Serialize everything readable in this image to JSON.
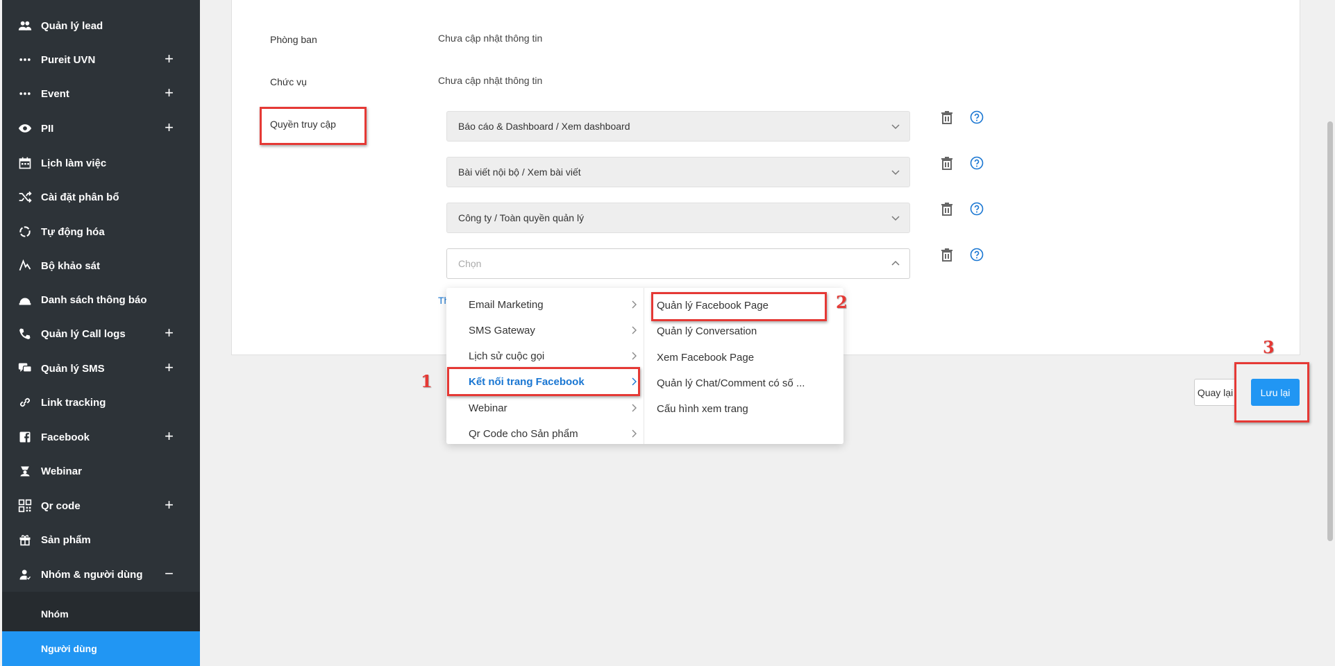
{
  "sidebar": {
    "items": [
      {
        "label": "Quản lý lead",
        "icon": "users-icon",
        "expand": ""
      },
      {
        "label": "Pureit UVN",
        "icon": "dots-icon",
        "expand": "+"
      },
      {
        "label": "Event",
        "icon": "dots-icon",
        "expand": "+"
      },
      {
        "label": "PII",
        "icon": "eye-icon",
        "expand": "+"
      },
      {
        "label": "Lịch làm việc",
        "icon": "calendar-icon",
        "expand": ""
      },
      {
        "label": "Cài đặt phân bổ",
        "icon": "shuffle-icon",
        "expand": ""
      },
      {
        "label": "Tự động hóa",
        "icon": "automation-icon",
        "expand": ""
      },
      {
        "label": "Bộ khảo sát",
        "icon": "survey-icon",
        "expand": ""
      },
      {
        "label": "Danh sách thông báo",
        "icon": "notification-icon",
        "expand": ""
      },
      {
        "label": "Quản lý Call logs",
        "icon": "phone-icon",
        "expand": "+"
      },
      {
        "label": "Quản lý SMS",
        "icon": "chat-icon",
        "expand": "+"
      },
      {
        "label": "Link tracking",
        "icon": "link-icon",
        "expand": ""
      },
      {
        "label": "Facebook",
        "icon": "facebook-icon",
        "expand": "+"
      },
      {
        "label": "Webinar",
        "icon": "webinar-icon",
        "expand": ""
      },
      {
        "label": "Qr code",
        "icon": "qrcode-icon",
        "expand": "+"
      },
      {
        "label": "Sản phẩm",
        "icon": "gift-icon",
        "expand": ""
      },
      {
        "label": "Nhóm & người dùng",
        "icon": "user-group-icon",
        "expand": "−"
      }
    ],
    "sub_items": [
      {
        "label": "Nhóm"
      },
      {
        "label": "Người dùng"
      }
    ]
  },
  "form": {
    "dept_label": "Phòng ban",
    "dept_value": "Chưa cập nhật thông tin",
    "position_label": "Chức vụ",
    "position_value": "Chưa cập nhật thông tin",
    "access_label": "Quyền truy cập",
    "permissions": [
      "Báo cáo & Dashboard / Xem dashboard",
      "Bài viết nội bộ / Xem bài viết",
      "Công ty / Toàn quyền quản lý"
    ],
    "select_placeholder": "Chọn",
    "add_link": "Th"
  },
  "dropdown": {
    "categories": [
      "Email Marketing",
      "SMS Gateway",
      "Lịch sử cuộc gọi",
      "Kết nối trang Facebook",
      "Webinar",
      "Qr Code cho Sản phẩm"
    ],
    "active_category": "Kết nối trang Facebook",
    "actions": [
      "Quản lý Facebook Page",
      "Quản lý Conversation",
      "Xem Facebook Page",
      "Quản lý Chat/Comment có số ...",
      "Cấu hình xem trang"
    ]
  },
  "buttons": {
    "back": "Quay lại",
    "save": "Lưu lại"
  },
  "annotations": {
    "step1": "1",
    "step2": "2",
    "step3": "3"
  },
  "colors": {
    "sidebar_bg": "#2d3338",
    "accent": "#2196f3",
    "annotation": "#e53935"
  }
}
